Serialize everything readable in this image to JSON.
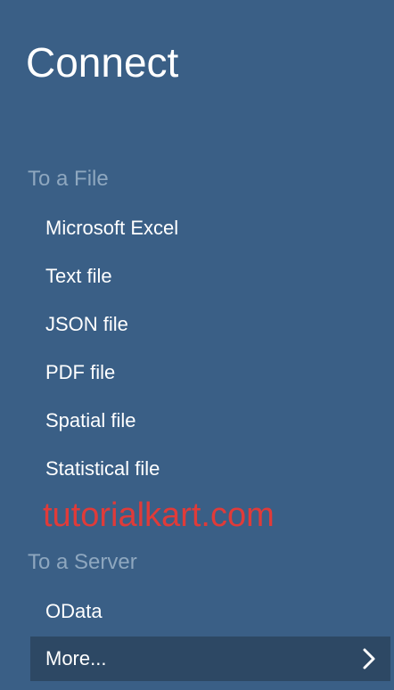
{
  "panel": {
    "title": "Connect",
    "sections": [
      {
        "heading": "To a File",
        "items": [
          {
            "label": "Microsoft Excel"
          },
          {
            "label": "Text file"
          },
          {
            "label": "JSON file"
          },
          {
            "label": "PDF file"
          },
          {
            "label": "Spatial file"
          },
          {
            "label": "Statistical file"
          }
        ]
      },
      {
        "heading": "To a Server",
        "items": [
          {
            "label": "OData"
          },
          {
            "label": "More..."
          }
        ]
      }
    ],
    "watermark_text": "tutorialkart.com",
    "colors": {
      "background": "#3a5f86",
      "heading": "#8ea7bf",
      "item_text": "#ffffff",
      "selected_item_background": "#2d4864",
      "watermark": "#e03b39"
    },
    "icons": {
      "more_chevron": "chevron-right-icon"
    }
  }
}
